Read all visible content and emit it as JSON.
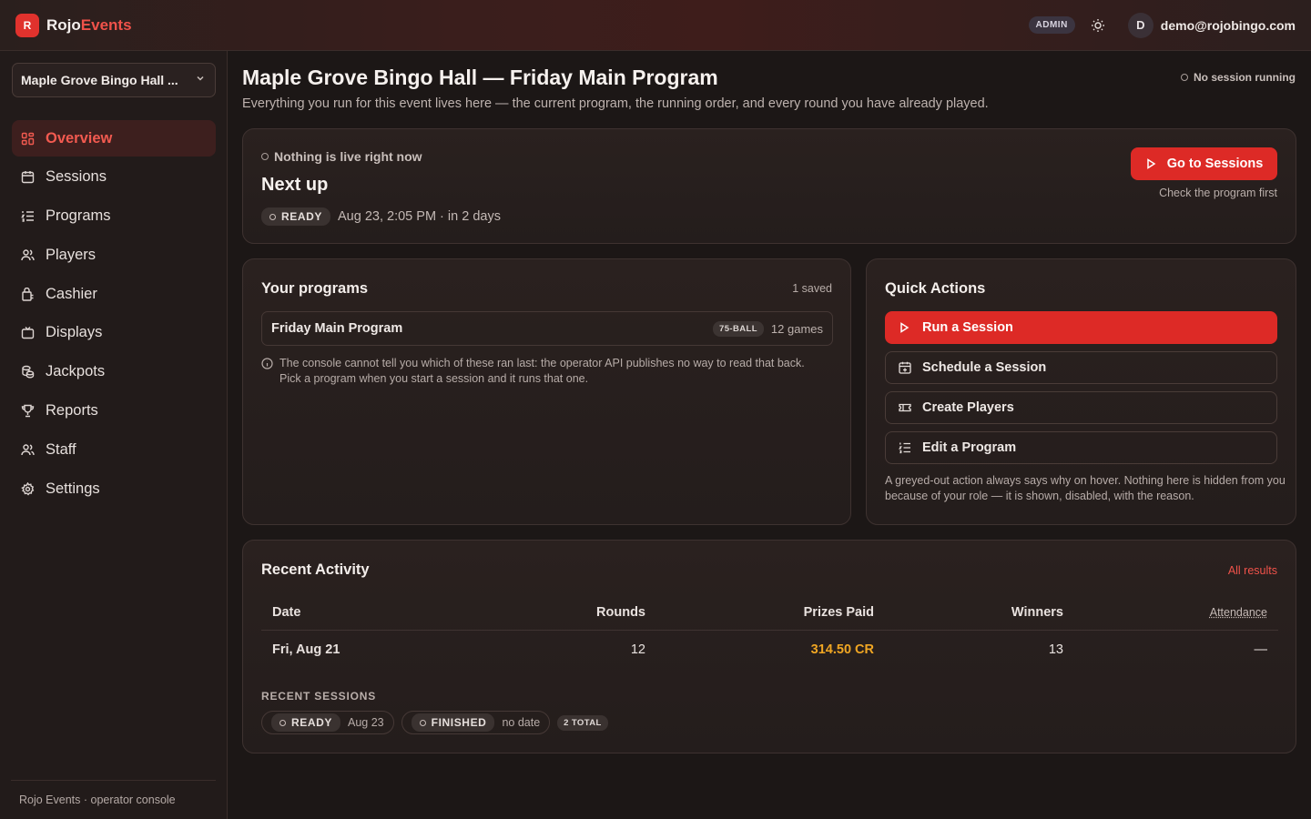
{
  "brand": {
    "mark": "R",
    "part1": "Rojo",
    "part2": "Events"
  },
  "topbar": {
    "role_badge": "ADMIN",
    "avatar_initial": "D",
    "user_email": "demo@rojobingo.com"
  },
  "sidebar": {
    "venue": "Maple Grove Bingo Hall ...",
    "items": [
      {
        "label": "Overview",
        "icon": "overview-icon",
        "active": true
      },
      {
        "label": "Sessions",
        "icon": "calendar-icon"
      },
      {
        "label": "Programs",
        "icon": "list-icon"
      },
      {
        "label": "Players",
        "icon": "users-icon"
      },
      {
        "label": "Cashier",
        "icon": "cashier-icon"
      },
      {
        "label": "Displays",
        "icon": "tv-icon"
      },
      {
        "label": "Jackpots",
        "icon": "coins-icon"
      },
      {
        "label": "Reports",
        "icon": "trophy-icon"
      },
      {
        "label": "Staff",
        "icon": "staff-icon"
      },
      {
        "label": "Settings",
        "icon": "gear-icon"
      }
    ],
    "footer": "Rojo Events · operator console"
  },
  "page": {
    "title": "Maple Grove Bingo Hall — Friday Main Program",
    "subtitle": "Everything you run for this event lives here — the current program, the running order, and every round you have already played.",
    "session_status": "No session running"
  },
  "next_up": {
    "live_status": "Nothing is live right now",
    "title": "Next up",
    "status_chip": "READY",
    "meta": "Aug 23, 2:05 PM · in 2 days",
    "button": "Go to Sessions",
    "button_hint": "Check the program first"
  },
  "programs": {
    "title": "Your programs",
    "count": "1 saved",
    "items": [
      {
        "name": "Friday Main Program",
        "badge": "75-BALL",
        "games": "12 games"
      }
    ],
    "note": "The console cannot tell you which of these ran last: the operator API publishes no way to read that back. Pick a program when you start a session and it runs that one."
  },
  "quick_actions": {
    "title": "Quick Actions",
    "buttons": [
      "Run a Session",
      "Schedule a Session",
      "Create Players",
      "Edit a Program"
    ],
    "note": "A greyed-out action always says why on hover. Nothing here is hidden from you because of your role — it is shown, disabled, with the reason."
  },
  "activity": {
    "title": "Recent Activity",
    "link": "All results",
    "columns": [
      "Date",
      "Rounds",
      "Prizes Paid",
      "Winners",
      "Attendance"
    ],
    "rows": [
      {
        "date": "Fri, Aug 21",
        "rounds": "12",
        "prizes": "314.50 CR",
        "winners": "13",
        "attendance": "—"
      }
    ],
    "recent_sessions_label": "RECENT SESSIONS",
    "sessions": [
      {
        "status": "READY",
        "date": "Aug 23"
      },
      {
        "status": "FINISHED",
        "date": "no date"
      }
    ],
    "total": "2 TOTAL"
  },
  "colors": {
    "accent": "#dd2a26",
    "brand_red": "#f0524a",
    "prize": "#f0a623"
  }
}
